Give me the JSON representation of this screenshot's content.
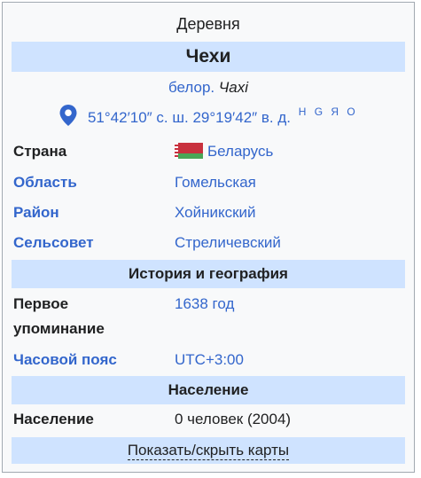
{
  "infobox": {
    "above": "Деревня",
    "title": "Чехи",
    "native_lang": "белор.",
    "native_name": "Чахі",
    "coordinates": "51°42′10″ с. ш. 29°19′42″ в. д.",
    "map_links": "H G Я O",
    "rows": [
      {
        "label": "Страна",
        "value": "Беларусь"
      },
      {
        "label": "Область",
        "value": "Гомельская"
      },
      {
        "label": "Район",
        "value": "Хойникский"
      },
      {
        "label": "Сельсовет",
        "value": "Стреличевский"
      }
    ],
    "section_history": "История и география",
    "first_mention_label_1": "Первое",
    "first_mention_label_2": "упоминание",
    "first_mention_value": "1638 год",
    "timezone_label": "Часовой пояс",
    "timezone_value": "UTC+3:00",
    "section_population": "Население",
    "population_label": "Население",
    "population_value": "0 человек (2004)",
    "toggle_maps": "Показать/скрыть карты"
  },
  "colors": {
    "band": "#cfe3ff",
    "link": "#3366cc",
    "flag_red": "#c8313e",
    "flag_green": "#4aa657"
  }
}
